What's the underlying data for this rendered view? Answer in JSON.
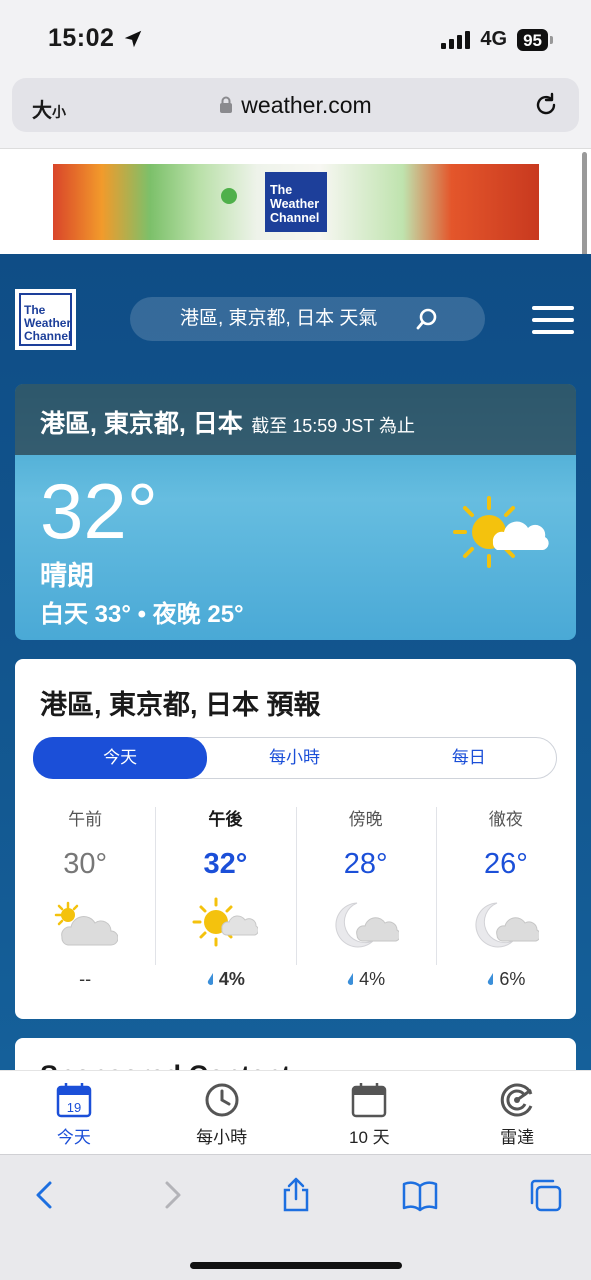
{
  "status_bar": {
    "time": "15:02",
    "network": "4G",
    "battery": "95"
  },
  "browser": {
    "text_size_label": "大",
    "text_size_small": "小",
    "url": "weather.com"
  },
  "ad": {
    "logo_line1": "The",
    "logo_line2": "Weather",
    "logo_line3": "Channel"
  },
  "header": {
    "logo_line1": "The",
    "logo_line2": "Weather",
    "logo_line3": "Channel",
    "search_text": "港區, 東京都, 日本 天氣"
  },
  "current": {
    "location": "港區, 東京都, 日本",
    "as_of": "截至 15:59 JST 為止",
    "temperature": "32°",
    "phrase": "晴朗",
    "hi_lo": "白天 33° • 夜晚 25°",
    "icon": "sunny-partly-cloudy-icon"
  },
  "forecast": {
    "title": "港區, 東京都, 日本 預報",
    "tabs": [
      {
        "label": "今天",
        "active": true
      },
      {
        "label": "每小時",
        "active": false
      },
      {
        "label": "每日",
        "active": false
      }
    ],
    "periods": [
      {
        "label": "午前",
        "temp": "30°",
        "precip": "--",
        "icon": "partly-cloudy-day-icon"
      },
      {
        "label": "午後",
        "temp": "32°",
        "precip": "4%",
        "icon": "sunny-partly-cloudy-icon"
      },
      {
        "label": "傍晚",
        "temp": "28°",
        "precip": "4%",
        "icon": "partly-cloudy-night-icon"
      },
      {
        "label": "徹夜",
        "temp": "26°",
        "precip": "6%",
        "icon": "partly-cloudy-night-icon"
      }
    ]
  },
  "next_card": {
    "title": "Sponsored Content"
  },
  "app_tabs": [
    {
      "label": "今天",
      "calendar_day": "19",
      "active": true
    },
    {
      "label": "每小時",
      "active": false
    },
    {
      "label": "10 天",
      "active": false
    },
    {
      "label": "雷達",
      "active": false
    }
  ],
  "colors": {
    "accent": "#1b4fd8",
    "page_bg": "#12558e",
    "brand": "#1d3f9a"
  }
}
